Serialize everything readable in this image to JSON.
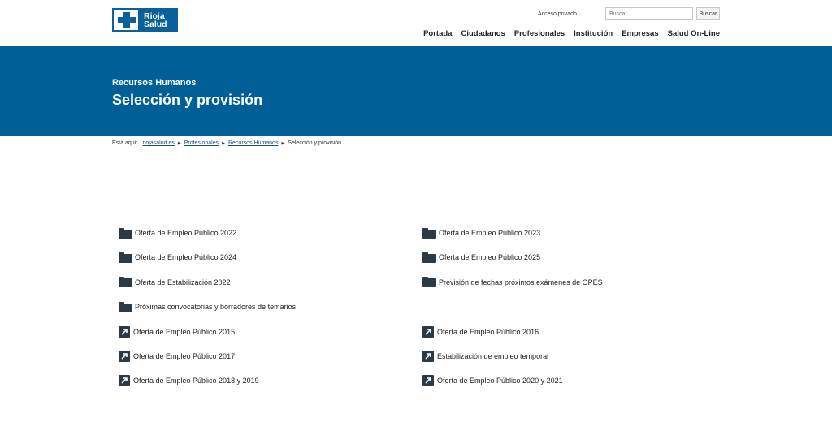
{
  "header": {
    "logo": {
      "line1": "Rioja",
      "line2": "Salud"
    },
    "acceso_privado": "Acceso privado",
    "search": {
      "placeholder": "Buscar...",
      "button": "Buscar"
    },
    "nav": [
      "Portada",
      "Ciudadanos",
      "Profesionales",
      "Institución",
      "Empresas",
      "Salud On-Line"
    ]
  },
  "banner": {
    "subtitle": "Recursos Humanos",
    "title": "Selección y provisión"
  },
  "breadcrumb": {
    "lead": "Está aquí:",
    "items": [
      "riojasalud.es",
      "Profesionales",
      "Recursos Humanos"
    ],
    "current": "Selección y provisión"
  },
  "links": [
    {
      "label": "Oferta de Empleo Público 2022",
      "icon": "folder-icon"
    },
    {
      "label": "Oferta de Empleo Público 2023",
      "icon": "folder-icon"
    },
    {
      "label": "Oferta de Empleo Público 2024",
      "icon": "folder-icon"
    },
    {
      "label": "Oferta de Empleo Público 2025",
      "icon": "folder-icon"
    },
    {
      "label": "Oferta de Estabilización 2022",
      "icon": "folder-icon"
    },
    {
      "label": "Previsión de fechas próximos exámenes de OPES",
      "icon": "folder-icon"
    },
    {
      "label": "Próximas convocatorias y borradores de temarios",
      "icon": "folder-icon"
    },
    {
      "label": "",
      "icon": ""
    },
    {
      "label": "Oferta de Empleo Público 2015",
      "icon": "external-link-icon"
    },
    {
      "label": "Oferta de Empleo Público 2016",
      "icon": "external-link-icon"
    },
    {
      "label": "Oferta de Empleo Público 2017",
      "icon": "external-link-icon"
    },
    {
      "label": "Estabilización de empleo temporal",
      "icon": "external-link-icon"
    },
    {
      "label": "Oferta de Empleo Público 2018 y 2019",
      "icon": "external-link-icon"
    },
    {
      "label": "Oferta de Empleo Público 2020 y 2021",
      "icon": "external-link-icon"
    }
  ],
  "colors": {
    "banner": "#005f96",
    "logo": "#0a6099",
    "icon": "#2d3a46"
  }
}
